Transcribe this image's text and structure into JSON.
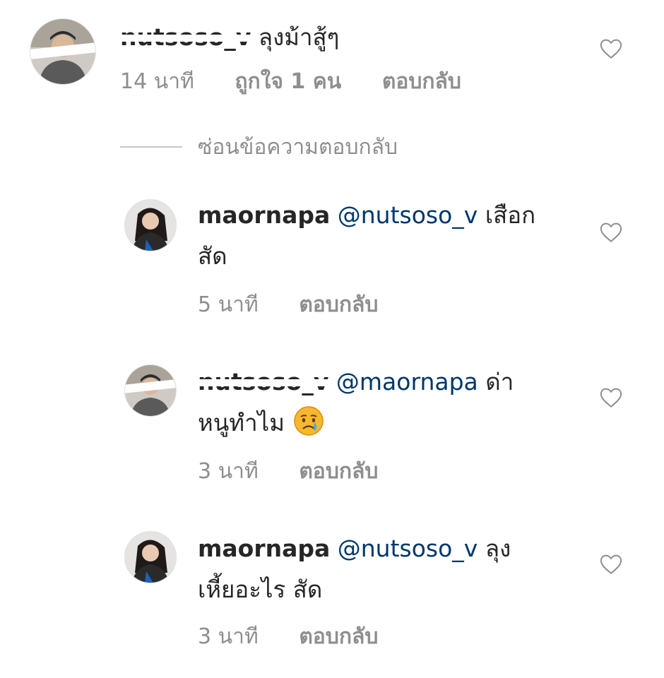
{
  "comments": [
    {
      "username": "nutsoso_v",
      "text": "ลุงม้าสู้ๆ",
      "time": "14 นาที",
      "likes": "ถูกใจ 1 คน",
      "reply": "ตอบกลับ",
      "avatar_icon": "profile-photo-man"
    },
    {
      "username": "maornapa",
      "mention": "@nutsoso_v",
      "text_line1": "เสือก",
      "text_line2": "สัด",
      "time": "5 นาที",
      "reply": "ตอบกลับ",
      "avatar_icon": "profile-photo-woman"
    },
    {
      "username": "nutsoso_v",
      "mention": "@maornapa",
      "text_line1": "ด่า",
      "text_line2": "หนูทำไม",
      "emoji_icon": "crying-face-emoji",
      "time": "3 นาที",
      "reply": "ตอบกลับ",
      "avatar_icon": "profile-photo-man"
    },
    {
      "username": "maornapa",
      "mention": "@nutsoso_v",
      "text_line1": "ลุง",
      "text_line2": "เหี้ยอะไร สัด",
      "time": "3 นาที",
      "reply": "ตอบกลับ",
      "avatar_icon": "profile-photo-woman"
    }
  ],
  "hide_replies": "ซ่อนข้อความตอบกลับ",
  "heart_icon": "heart-outline-icon",
  "colors": {
    "text": "#262626",
    "meta": "#8e8e8e",
    "mention": "#00376b"
  }
}
